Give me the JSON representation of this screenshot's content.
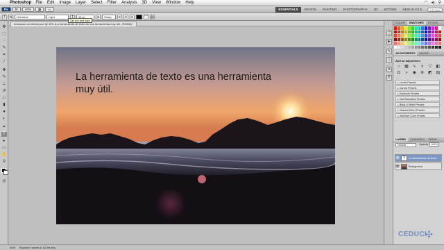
{
  "menubar": {
    "app_name": "Photoshop",
    "items": [
      "File",
      "Edit",
      "Image",
      "Layer",
      "Select",
      "Filter",
      "Analysis",
      "3D",
      "View",
      "Window",
      "Help"
    ]
  },
  "appbar": {
    "zoom": "40%",
    "workspaces": [
      "ESSENTIALS",
      "DESIGN",
      "PAINTING",
      "PHOTOGRAPHY",
      "3D",
      "MOTION",
      "NEW IN CS 5"
    ],
    "search_placeholder": "CS Live"
  },
  "options": {
    "font_family": "Helvetica",
    "font_style": "Light",
    "font_size": "25 pt",
    "antialias": "Sharp",
    "tooltip": "Set the font size"
  },
  "document": {
    "tab_title": "Imbuscar con efecto.psd @ 40% (La herramienta de texto es una herramienta muy útil., RGB/8) *"
  },
  "canvas": {
    "text_line1": "La herramienta de texto es una herramienta",
    "text_line2": "muy útil."
  },
  "panels": {
    "top_tabs": [
      "COLOR",
      "SWATCHES",
      "STYLES"
    ],
    "adj_tabs": [
      "ADJUSTMENTS",
      "MASKS"
    ],
    "adj_title": "Add an adjustment",
    "presets": [
      "Levels Presets",
      "Curves Presets",
      "Exposure Presets",
      "Hue/Saturation Presets",
      "Black & White Presets",
      "Channel Mixer Presets",
      "Selective Color Presets"
    ],
    "layer_tabs": [
      "LAYERS",
      "CHANNELS",
      "PATHS"
    ],
    "blend_mode": "Normal",
    "opacity_label": "Opacity:",
    "opacity_value": "100%",
    "layers": [
      {
        "name": "La herramienta de texto...",
        "type": "T"
      },
      {
        "name": "Background",
        "type": "img"
      }
    ]
  },
  "status": {
    "zoom": "40%",
    "info": "Exposure works in 32-bit only"
  },
  "watermark": {
    "text": "CEDUCI"
  },
  "colors": {
    "selected_layer": "#7c97c7",
    "watermark": "#6e8dbe"
  }
}
